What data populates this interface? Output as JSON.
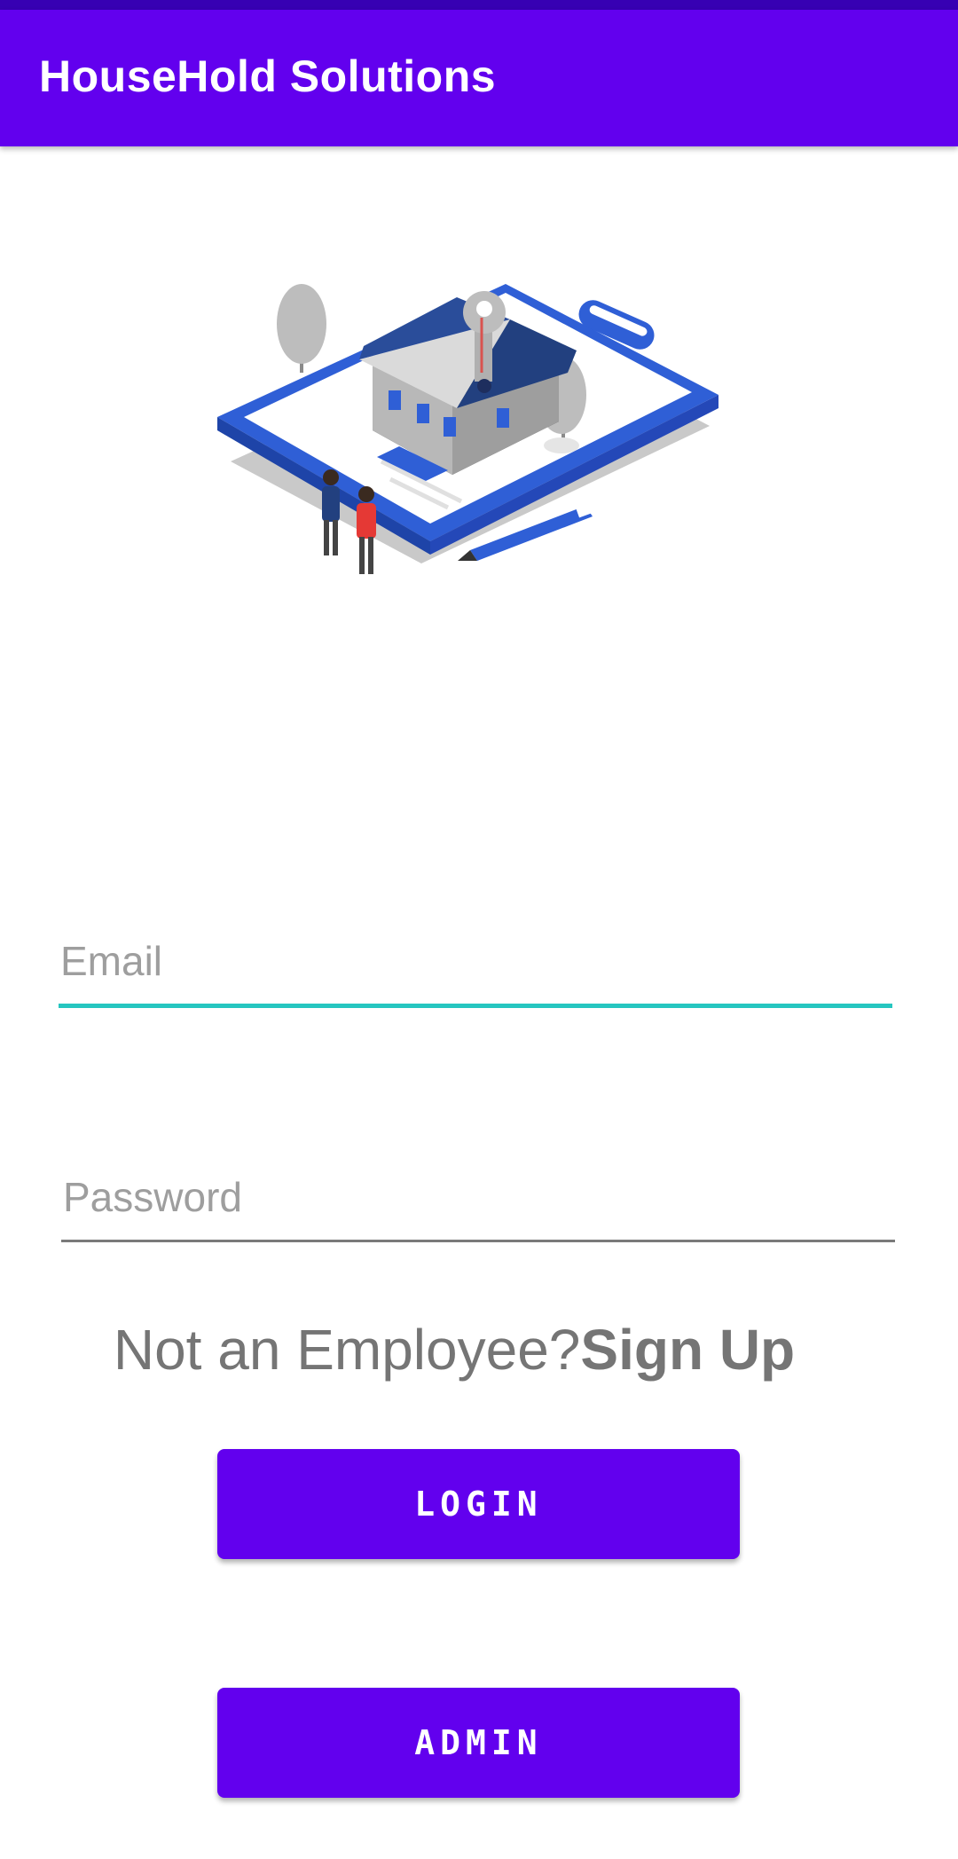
{
  "app_bar": {
    "title": "HouseHold Solutions"
  },
  "form": {
    "email": {
      "placeholder": "Email",
      "value": ""
    },
    "password": {
      "placeholder": "Password",
      "value": ""
    }
  },
  "signup": {
    "prompt": "Not an Employee?",
    "link": "Sign Up"
  },
  "buttons": {
    "login": "LOGIN",
    "admin": "ADMIN"
  },
  "colors": {
    "primary": "#6200EE",
    "primary_dark": "#3700B3",
    "accent": "#26C6C0",
    "hint_text": "#9e9e9e",
    "body_text": "#757575"
  },
  "icons": {
    "hero": "house-on-clipboard-illustration"
  }
}
